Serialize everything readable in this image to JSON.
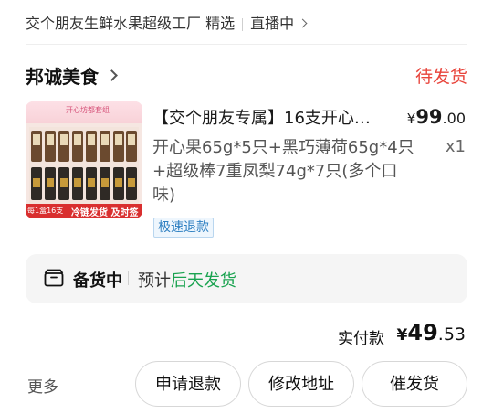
{
  "header": {
    "store_text": "交个朋友生鲜水果超级工厂 精选",
    "live_label": "直播中"
  },
  "order": {
    "shop_name": "邦诚美食",
    "status": "待发货"
  },
  "product": {
    "image_banner_text": "开心坊都套组",
    "image_tag_left": "每1盒16支",
    "image_tag_right": "冷链发货 及时签收",
    "title": "【交个朋友专属】16支开心…",
    "price_currency": "¥",
    "price_int": "99",
    "price_dec": ".00",
    "spec": "开心果65g*5只+黑巧薄荷65g*4只+超级棒7重凤梨74g*7只(多个口味)",
    "quantity": "x1",
    "refund_badge": "极速退款"
  },
  "stock": {
    "label": "备货中",
    "text_prefix": "预计",
    "text_highlight": "后天发货",
    "icon": "box-icon",
    "highlight_color": "#1aa350"
  },
  "payment": {
    "label": "实付款",
    "currency": "¥",
    "amount_int": "49",
    "amount_dec": ".53"
  },
  "actions": {
    "more_label": "更多",
    "refund_button": "申请退款",
    "address_button": "修改地址",
    "urge_button": "催发货"
  },
  "colors": {
    "status": "#e8453c",
    "refund_badge": "#2d7fc1"
  }
}
